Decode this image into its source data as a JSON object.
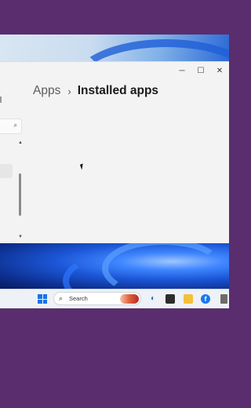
{
  "window": {
    "controls": {
      "minimize": "─",
      "maximize": "☐",
      "close": "✕"
    }
  },
  "breadcrumb": {
    "parent": "Apps",
    "separator": "›",
    "current": "Installed apps"
  },
  "sidebar": {
    "search_icon": "⌕"
  },
  "scrollbar": {
    "up": "▲",
    "down": "▼"
  },
  "taskbar": {
    "search_label": "Search",
    "search_glyph": "⌕",
    "icons": [
      "start-icon",
      "copilot-icon",
      "task-view-icon",
      "file-explorer-icon",
      "facebook-icon",
      "store-icon"
    ],
    "facebook_glyph": "f",
    "copilot_glyph": "◐"
  },
  "colors": {
    "backdrop": "#5a2d6e",
    "window_bg": "#f3f3f3",
    "taskbar_bg": "#eef1f6",
    "accent": "#1a73e8"
  }
}
